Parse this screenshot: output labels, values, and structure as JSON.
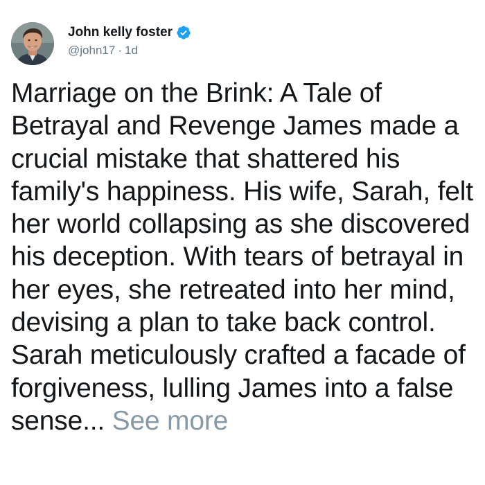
{
  "tweet": {
    "author": {
      "display_name": "John kelly foster",
      "handle": "@john17",
      "separator": "·",
      "age": "1d",
      "verified": true,
      "avatar_icon": "profile-photo-icon",
      "verified_icon": "verified-badge-icon"
    },
    "text": "Marriage on the Brink: A Tale of Betrayal and Revenge James made a crucial mistake that shattered his family's happiness. His wife, Sarah, felt her world collapsing as she discovered his deception. With tears of betrayal in her eyes, she retreated into her mind, devising a plan to take back control. Sarah meticulously crafted a facade of forgiveness, lulling James into a false sense...",
    "see_more_label": "See more"
  },
  "colors": {
    "text_primary": "#14171a",
    "text_secondary": "#657786",
    "see_more": "#8899a6",
    "verified_blue": "#1da1f2"
  }
}
